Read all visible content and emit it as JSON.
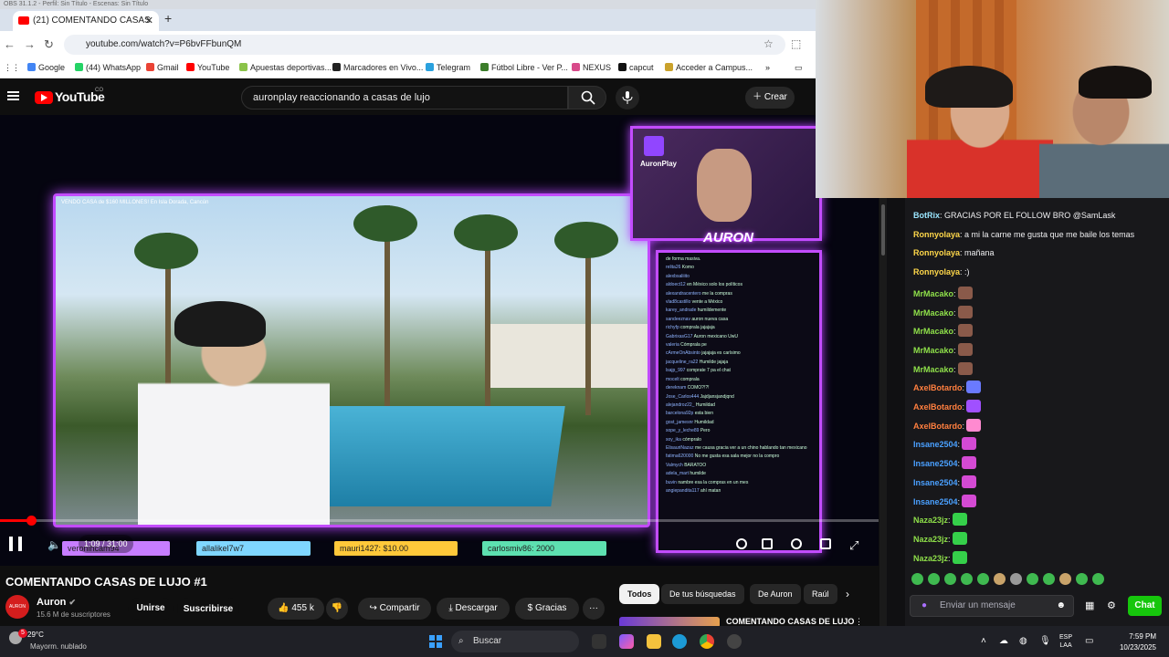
{
  "obs_title": "OBS 31.1.2 - Perfil: Sin Título - Escenas: Sin Título",
  "browser": {
    "tab_title": "(21) COMENTANDO CASAS",
    "url": "youtube.com/watch?v=P6bvFFbunQM",
    "bookmarks": [
      {
        "label": "Google",
        "color": "#4285f4"
      },
      {
        "label": "(44) WhatsApp",
        "color": "#25d366"
      },
      {
        "label": "Gmail",
        "color": "#ea4335"
      },
      {
        "label": "YouTube",
        "color": "#ff0000"
      },
      {
        "label": "Apuestas deportivas...",
        "color": "#8bc34a"
      },
      {
        "label": "Marcadores en Vivo...",
        "color": "#222222"
      },
      {
        "label": "Telegram",
        "color": "#2aa1de"
      },
      {
        "label": "Fútbol Libre - Ver P...",
        "color": "#3b7d2a"
      },
      {
        "label": "NEXUS",
        "color": "#d84a8a"
      },
      {
        "label": "capcut",
        "color": "#111111"
      },
      {
        "label": "Acceder a Campus...",
        "color": "#caa22c"
      }
    ]
  },
  "youtube": {
    "logo_text": "YouTube",
    "logo_country": "CO",
    "search_query": "auronplay reaccionando a casas de lujo",
    "create_label": "Crear",
    "video": {
      "caption_tiny": "VENDO CASA de $160 MILLONES! En Isla Dorada, Cancún",
      "cam_tag": "AuronPlay",
      "streamer_name": "AURON",
      "stream_chat": [
        {
          "user": "",
          "msg": "de forma masiva."
        },
        {
          "user": "relita26",
          "msg": "Komo"
        },
        {
          "user": "alexbsaliiito",
          "msg": ""
        },
        {
          "user": "aldoect12",
          "msg": "en México solo los políticos"
        },
        {
          "user": "alexandracentero",
          "msg": "me la compras"
        },
        {
          "user": "vlad8castillo",
          "msg": "vente a México"
        },
        {
          "user": "karey_andrade",
          "msg": "humildemente"
        },
        {
          "user": "sandeeznav",
          "msg": "auron nueva casa"
        },
        {
          "user": "richyfp",
          "msg": "comprala jajajaja"
        },
        {
          "user": "GabrixasG17",
          "msg": "Auron mexicano UwU"
        },
        {
          "user": "valeria",
          "msg": "Cómprala pe"
        },
        {
          "user": "cArmeOnAbsinto",
          "msg": "jajajaja es carísimo"
        },
        {
          "user": "jacqueline_ra22",
          "msg": "Humilde jajaja"
        },
        {
          "user": "lsajp_997",
          "msg": "comprate 7 pa el chat"
        },
        {
          "user": "mocelt",
          "msg": "comprala"
        },
        {
          "user": "dereknam",
          "msg": "COMO?!?!"
        },
        {
          "user": "Jose_Carlos444",
          "msg": "Jajdjansjandjqnd"
        },
        {
          "user": "alejandroz22_",
          "msg": "Humildad"
        },
        {
          "user": "barcelona92p",
          "msg": "esta bien"
        },
        {
          "user": "gost_jamesnr",
          "msg": "Humildad"
        },
        {
          "user": "sope_y_leche89",
          "msg": "Pero"
        },
        {
          "user": "soy_ika",
          "msg": "cómpralo"
        },
        {
          "user": "ElisauriNazaz",
          "msg": "me causa gracia ver a un chino hablando tan mexicano"
        },
        {
          "user": "fatima620000",
          "msg": "No me gusta esa sala mejor no la compro"
        },
        {
          "user": "Valmych",
          "msg": "BARATOO"
        },
        {
          "user": "adela_mart",
          "msg": "humilde"
        },
        {
          "user": "buvin",
          "msg": "nambre esa la compras en un mes"
        },
        {
          "user": "angiepandita117",
          "msg": "ahí matan"
        }
      ],
      "alerts": [
        {
          "text": "veronihcam94",
          "color": "#c77dff"
        },
        {
          "text": "allalikel7w7",
          "color": "#7fd6ff"
        },
        {
          "text": "mauri1427: $10.00",
          "color": "#ffc83a"
        },
        {
          "text": "carlosmiv86: 2000",
          "color": "#5de0b0"
        }
      ],
      "progress_fraction": 0.035,
      "time_label": "1:09 / 31:00"
    },
    "title": "COMENTANDO CASAS DE LUJO #1",
    "channel": "Auron",
    "channel_avatar_text": "AURON",
    "subscribers": "15.6 M de suscriptores",
    "join_label": "Unirse",
    "subscribe_label": "Suscribirse",
    "likes": "455 k",
    "share_label": "Compartir",
    "download_label": "Descargar",
    "thanks_label": "Gracias",
    "more_label": "···",
    "chips": [
      "Todos",
      "De tus búsquedas",
      "De Auron",
      "Raúl"
    ],
    "related_title": "COMENTANDO CASAS DE LUJO"
  },
  "twitch_chat": {
    "messages": [
      {
        "user": "BotRix",
        "color": "#9ae6ff",
        "msg": ": GRACIAS POR EL FOLLOW BRO @SamLask",
        "emote": ""
      },
      {
        "user": "Ronnyolaya",
        "color": "#ffd84a",
        "msg": ": a mi la carne me gusta que me baile los temas",
        "emote": ""
      },
      {
        "user": "Ronnyolaya",
        "color": "#ffd84a",
        "msg": ": mañana",
        "emote": ""
      },
      {
        "user": "Ronnyolaya",
        "color": "#ffd84a",
        "msg": ": :)",
        "emote": ""
      },
      {
        "user": "MrMacako",
        "color": "#8fe04a",
        "msg": ":",
        "emote": "#8a5a4a"
      },
      {
        "user": "MrMacako",
        "color": "#8fe04a",
        "msg": ":",
        "emote": "#8a5a4a"
      },
      {
        "user": "MrMacako",
        "color": "#8fe04a",
        "msg": ":",
        "emote": "#8a5a4a"
      },
      {
        "user": "MrMacako",
        "color": "#8fe04a",
        "msg": ":",
        "emote": "#8a5a4a"
      },
      {
        "user": "MrMacako",
        "color": "#8fe04a",
        "msg": ":",
        "emote": "#8a5a4a"
      },
      {
        "user": "AxelBotardo",
        "color": "#ff7f3f",
        "msg": ":",
        "emote": "#6a7aff"
      },
      {
        "user": "AxelBotardo",
        "color": "#ff7f3f",
        "msg": ":",
        "emote": "#a050ff"
      },
      {
        "user": "AxelBotardo",
        "color": "#ff7f3f",
        "msg": ":",
        "emote": "#ff8ad0"
      },
      {
        "user": "Insane2504",
        "color": "#4aa0ff",
        "msg": ":",
        "emote": "#d44ad4"
      },
      {
        "user": "Insane2504",
        "color": "#4aa0ff",
        "msg": ":",
        "emote": "#d44ad4"
      },
      {
        "user": "Insane2504",
        "color": "#4aa0ff",
        "msg": ":",
        "emote": "#d44ad4"
      },
      {
        "user": "Insane2504",
        "color": "#4aa0ff",
        "msg": ":",
        "emote": "#d44ad4"
      },
      {
        "user": "Naza23jz",
        "color": "#8fe04a",
        "msg": ":",
        "emote": "#35d04a"
      },
      {
        "user": "Naza23jz",
        "color": "#8fe04a",
        "msg": ":",
        "emote": "#35d04a"
      },
      {
        "user": "Naza23jz",
        "color": "#8fe04a",
        "msg": ":",
        "emote": "#35d04a"
      }
    ],
    "input_placeholder": "Enviar un mensaje",
    "send_label": "Chat"
  },
  "taskbar": {
    "temperature": "29°C",
    "weather": "Mayorm. nublado",
    "notifications": "5",
    "search_label": "Buscar",
    "lang_top": "ESP",
    "lang_bottom": "LAA",
    "time": "7:59 PM",
    "date": "10/23/2025"
  }
}
